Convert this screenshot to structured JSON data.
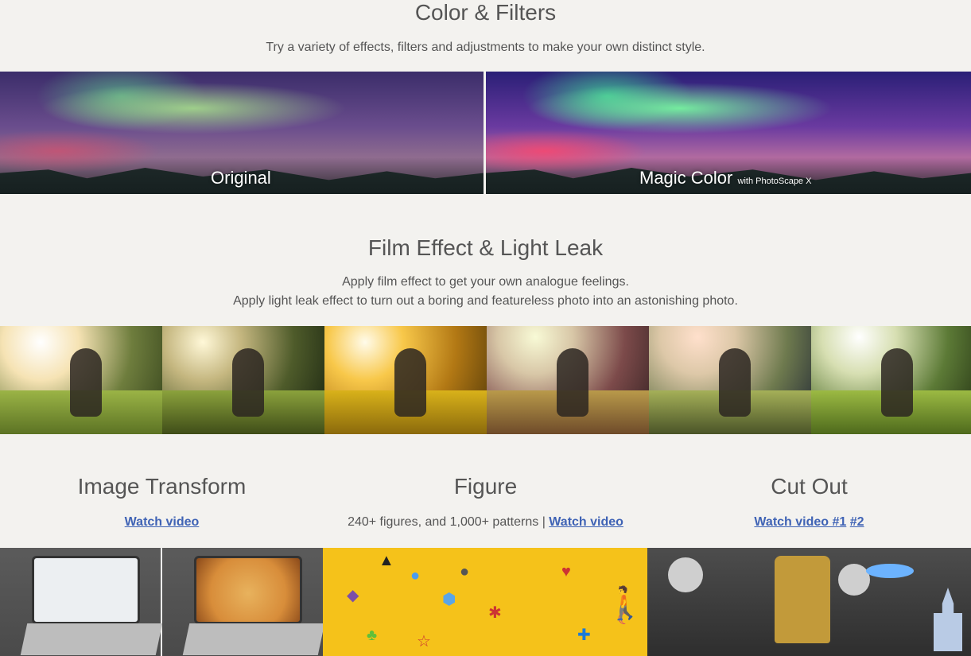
{
  "color_filters": {
    "title": "Color & Filters",
    "subtitle": "Try a variety of effects, filters and adjustments to make your own distinct style.",
    "left_label": "Original",
    "right_label_main": "Magic Color",
    "right_label_small": "with PhotoScape X"
  },
  "film_effect": {
    "title": "Film Effect & Light Leak",
    "line1": "Apply film effect to get your own analogue feelings.",
    "line2": "Apply light leak effect to turn out a boring and featureless photo into an astonishing photo."
  },
  "features": {
    "image_transform": {
      "title": "Image Transform",
      "link": "Watch video"
    },
    "figure": {
      "title": "Figure",
      "text": "240+ figures, and 1,000+ patterns | ",
      "link": "Watch video"
    },
    "cut_out": {
      "title": "Cut Out",
      "link1": "Watch video #1",
      "link2": "#2"
    }
  },
  "colors": {
    "background": "#f3f2ef",
    "text": "#555555",
    "link": "#3f63b5"
  }
}
